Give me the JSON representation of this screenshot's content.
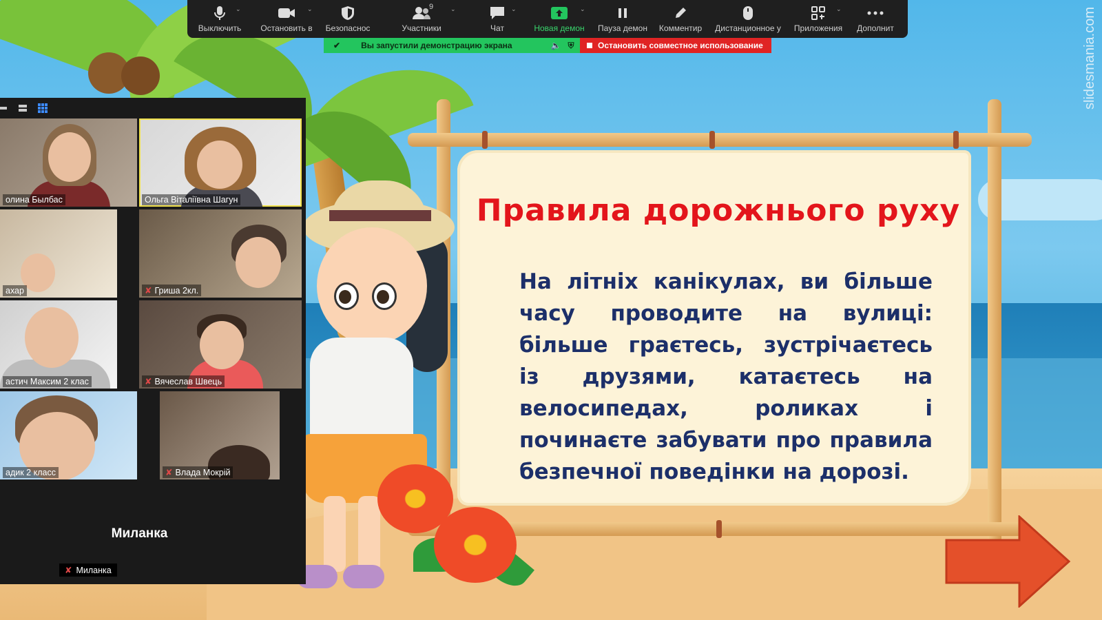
{
  "toolbar": {
    "items": [
      {
        "label": "Выключить"
      },
      {
        "label": "Остановить в"
      },
      {
        "label": "Безопаснос"
      },
      {
        "label": "Участники",
        "count": "9"
      },
      {
        "label": "Чат"
      },
      {
        "label": "Новая демон"
      },
      {
        "label": "Пауза демон"
      },
      {
        "label": "Комментир"
      },
      {
        "label": "Дистанционное у"
      },
      {
        "label": "Приложения"
      },
      {
        "label": "Дополнит"
      }
    ]
  },
  "share": {
    "status_text": "Вы запустили демонстрацию экрана",
    "stop_label": "Остановить совместное использование"
  },
  "gallery": {
    "tiles": [
      {
        "name": "олина Былбас"
      },
      {
        "name": "Ольга Віталіївна Шагун"
      },
      {
        "name": "ахар"
      },
      {
        "name": "Гриша 2кл."
      },
      {
        "name": "астич Максим 2 клас"
      },
      {
        "name": "Вячеслав Швець"
      },
      {
        "name": "адик 2 класс"
      },
      {
        "name": "Влада Мокрій"
      }
    ],
    "audio_only": {
      "name_large": "Миланка",
      "name_small": "Миланка"
    }
  },
  "slide": {
    "title": "Правила дорожнього руху",
    "body": "На літніх канікулах, ви більше часу проводите на вулиці: більше граєтесь, зустрічаєтесь із друзями, катаєтесь на велосипедах, роликах і починаєте забувати про правила безпечної поведінки на дорозі.",
    "watermark": "slidesmania.com"
  },
  "colors": {
    "title": "#e3151b",
    "body": "#1c2f69",
    "share_green": "#23c55e",
    "stop_red": "#e02424",
    "arrow": "#e4502a"
  }
}
